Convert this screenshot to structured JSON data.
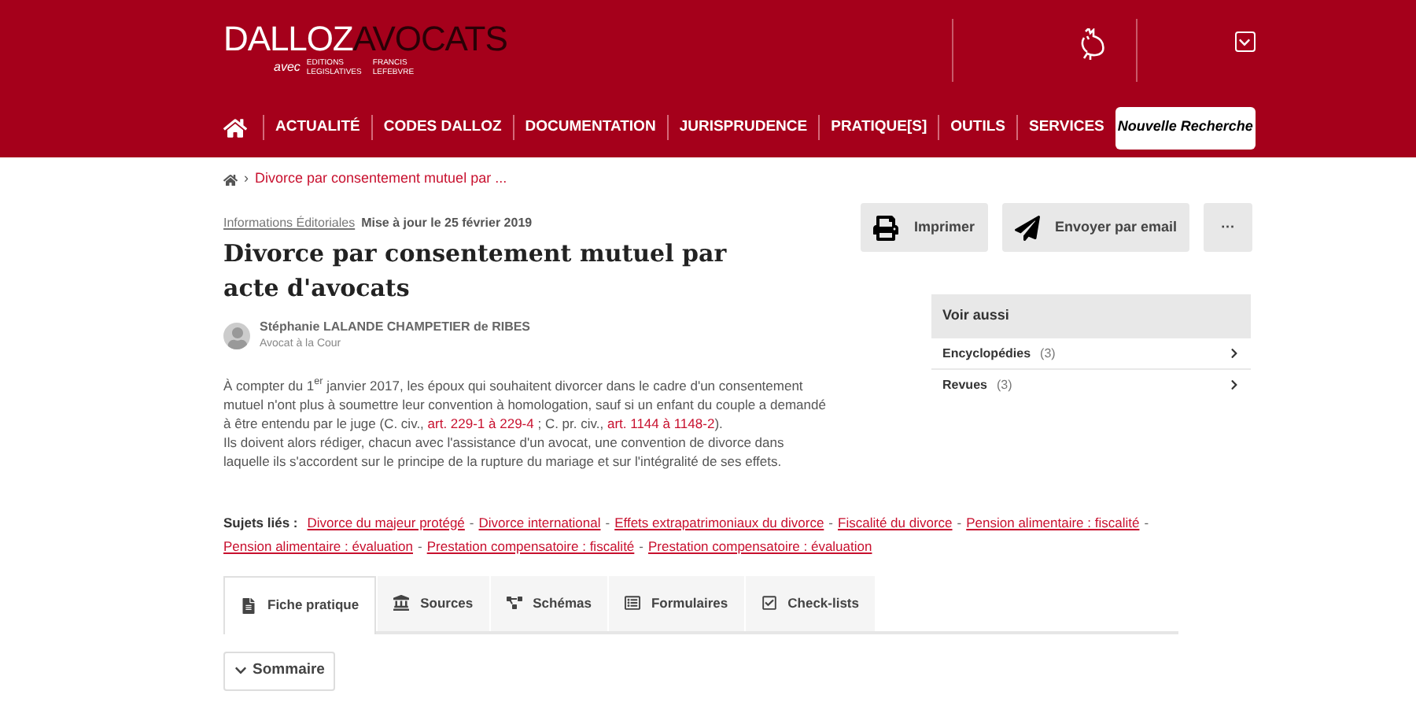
{
  "logo": {
    "part_1": "DALLOZ",
    "part_2": "AVOCATS",
    "with": "avec",
    "partner_1": "EDITIONS LEGISLATIVES",
    "partner_2": "FRANCIS LEFEBVRE"
  },
  "nav": {
    "items": [
      "ACTUALITÉ",
      "CODES DALLOZ",
      "DOCUMENTATION",
      "JURISPRUDENCE",
      "PRATIQUE[S]",
      "OUTILS",
      "SERVICES"
    ],
    "search_button": "Nouvelle Recherche"
  },
  "breadcrumb": {
    "separator": "›",
    "current": "Divorce par consentement mutuel par ..."
  },
  "article": {
    "category": "Informations Éditoriales",
    "updated": "Mise à jour le 25 février 2019",
    "title": "Divorce par consentement mutuel par acte d'avocats",
    "author": {
      "name": "Stéphanie LALANDE CHAMPETIER de RIBES",
      "role": "Avocat à la Cour"
    },
    "paragraphs": [
      [
        {
          "kind": "text",
          "text": "À compter du 1$^{er}$ janvier 2017, les époux qui souhaitent divorcer dans le cadre d'un consentement mutuel n'ont plus à soumettre leur convention à homologation, sauf si un enfant du couple a demandé à être entendu par le juge (C. civ., "
        },
        {
          "kind": "link",
          "text": "art. 229-1 à 229-4"
        },
        {
          "kind": "text",
          "text": " ; C. pr. civ., "
        },
        {
          "kind": "link",
          "text": "art. 1144 à 1148-2"
        },
        {
          "kind": "text",
          "text": ")."
        }
      ],
      [
        {
          "kind": "text",
          "text": "Ils doivent alors rédiger, chacun avec l'assistance d'un avocat, une convention de divorce dans laquelle ils s'accordent sur le principe de la rupture du mariage et sur l'intégralité de ses effets."
        }
      ]
    ]
  },
  "actions": [
    "Imprimer",
    "Envoyer par email",
    "···"
  ],
  "see_also": {
    "title": "Voir aussi",
    "items": [
      {
        "label": "Encyclopédies",
        "count": "(3)"
      },
      {
        "label": "Revues",
        "count": "(3)"
      }
    ]
  },
  "related": {
    "label": "Sujets liés :",
    "separator": "-",
    "links": [
      "Divorce du majeur protégé",
      "Divorce international",
      "Effets extrapatrimoniaux du divorce",
      "Fiscalité du divorce",
      "Pension alimentaire : fiscalité",
      "Pension alimentaire : évaluation",
      "Prestation compensatoire : fiscalité",
      "Prestation compensatoire : évaluation"
    ]
  },
  "tabs": [
    {
      "label": "Fiche pratique",
      "selected": true
    },
    {
      "label": "Sources",
      "selected": false
    },
    {
      "label": "Schémas",
      "selected": false
    },
    {
      "label": "Formulaires",
      "selected": false
    },
    {
      "label": "Check-lists",
      "selected": false
    }
  ],
  "summary_button": "Sommaire"
}
